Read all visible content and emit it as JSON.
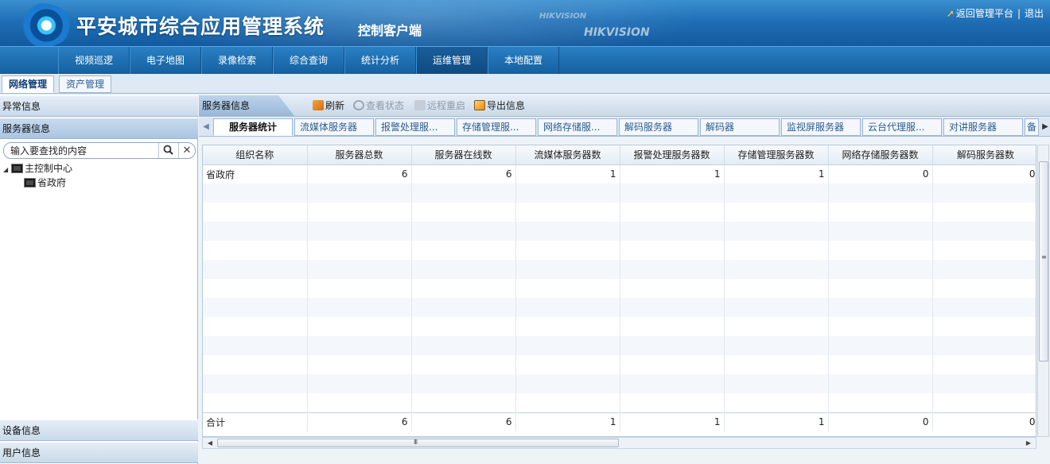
{
  "header": {
    "title": "平安城市综合应用管理系统",
    "subtitle": "控制客户端",
    "brand_small": "HIKVISION",
    "brand_large": "HIKVISION",
    "return_link": "返回管理平台",
    "separator": "|",
    "logout": "退出"
  },
  "main_nav": [
    {
      "label": "视频巡逻"
    },
    {
      "label": "电子地图"
    },
    {
      "label": "录像检索"
    },
    {
      "label": "综合查询"
    },
    {
      "label": "统计分析"
    },
    {
      "label": "运维管理",
      "active": true
    },
    {
      "label": "本地配置"
    }
  ],
  "sub_tabs": [
    {
      "label": "网络管理",
      "active": true
    },
    {
      "label": "资产管理"
    }
  ],
  "left_panel": {
    "sections": [
      "异常信息",
      "服务器信息",
      "设备信息",
      "用户信息"
    ],
    "active_section": "服务器信息",
    "search": {
      "value": "输入要查找的内容"
    },
    "tree": [
      {
        "label": "主控制中心",
        "expanded": true
      },
      {
        "label": "省政府"
      }
    ]
  },
  "right_panel": {
    "title": "服务器信息",
    "toolbar": [
      {
        "label": "刷新",
        "icon": "refresh-icon",
        "enabled": true
      },
      {
        "label": "查看状态",
        "icon": "view-status-icon",
        "enabled": false
      },
      {
        "label": "远程重启",
        "icon": "reboot-icon",
        "enabled": false
      },
      {
        "label": "导出信息",
        "icon": "export-icon",
        "enabled": true
      }
    ],
    "tabs": [
      {
        "label": "服务器统计",
        "active": true
      },
      {
        "label": "流媒体服务器"
      },
      {
        "label": "报警处理服..."
      },
      {
        "label": "存储管理服..."
      },
      {
        "label": "网络存储服..."
      },
      {
        "label": "解码服务器"
      },
      {
        "label": "解码器"
      },
      {
        "label": "监视屏服务器"
      },
      {
        "label": "云台代理服..."
      },
      {
        "label": "对讲服务器"
      },
      {
        "label": "备"
      }
    ],
    "table": {
      "columns": [
        "组织名称",
        "服务器总数",
        "服务器在线数",
        "流媒体服务器数",
        "报警处理服务器数",
        "存储管理服务器数",
        "网络存储服务器数",
        "解码服务器数"
      ],
      "rows": [
        [
          "省政府",
          "6",
          "6",
          "1",
          "1",
          "1",
          "0",
          "0"
        ]
      ],
      "total": [
        "合计",
        "6",
        "6",
        "1",
        "1",
        "1",
        "0",
        "0"
      ]
    },
    "hscroll_grip": "III"
  }
}
